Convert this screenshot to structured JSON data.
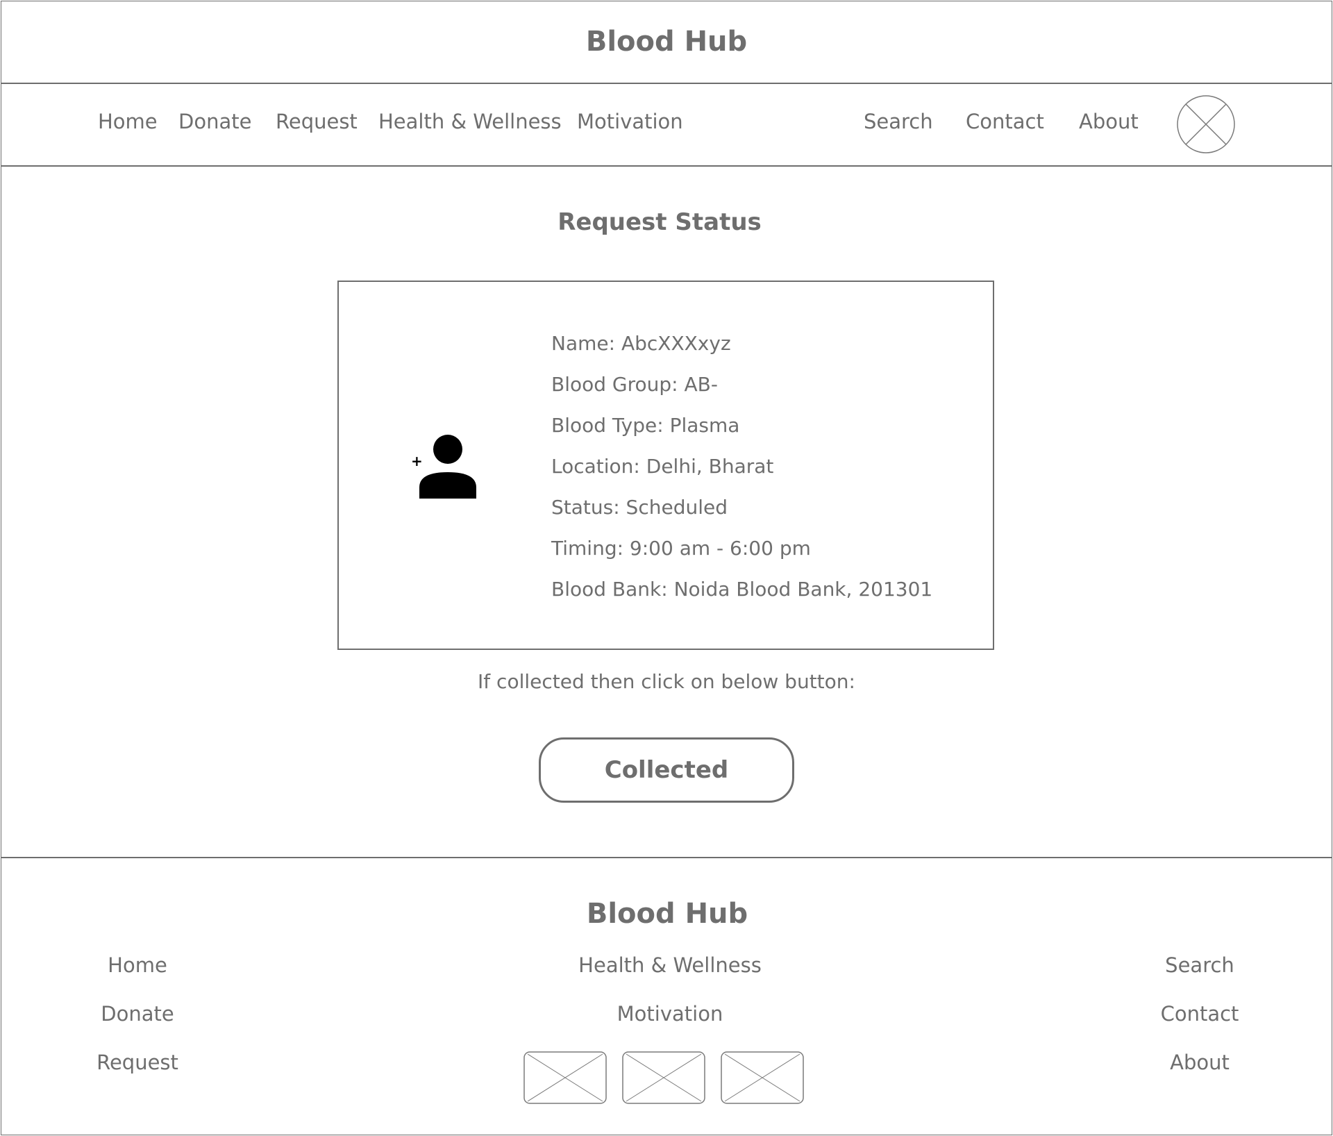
{
  "header": {
    "title": "Blood Hub"
  },
  "nav": {
    "home": "Home",
    "donate": "Donate",
    "request": "Request",
    "health": "Health & Wellness",
    "motivation": "Motivation",
    "search": "Search",
    "contact": "Contact",
    "about": "About"
  },
  "main": {
    "title": "Request Status",
    "details": [
      "Name: AbcXXXxyz",
      "Blood Group: AB-",
      "Blood Type: Plasma",
      "Location: Delhi, Bharat",
      "Status: Scheduled",
      "Timing: 9:00 am - 6:00 pm",
      "Blood Bank: Noida Blood Bank, 201301"
    ],
    "hint": "If collected then click on below button:",
    "button": "Collected"
  },
  "footer": {
    "title": "Blood Hub",
    "links": {
      "home": "Home",
      "donate": "Donate",
      "request": "Request",
      "health": "Health & Wellness",
      "motivation": "Motivation",
      "search": "Search",
      "contact": "Contact",
      "about": "About"
    }
  },
  "icons": {
    "profile": "image-placeholder-icon",
    "person": "add-person-icon",
    "social": "image-placeholder-icon"
  }
}
